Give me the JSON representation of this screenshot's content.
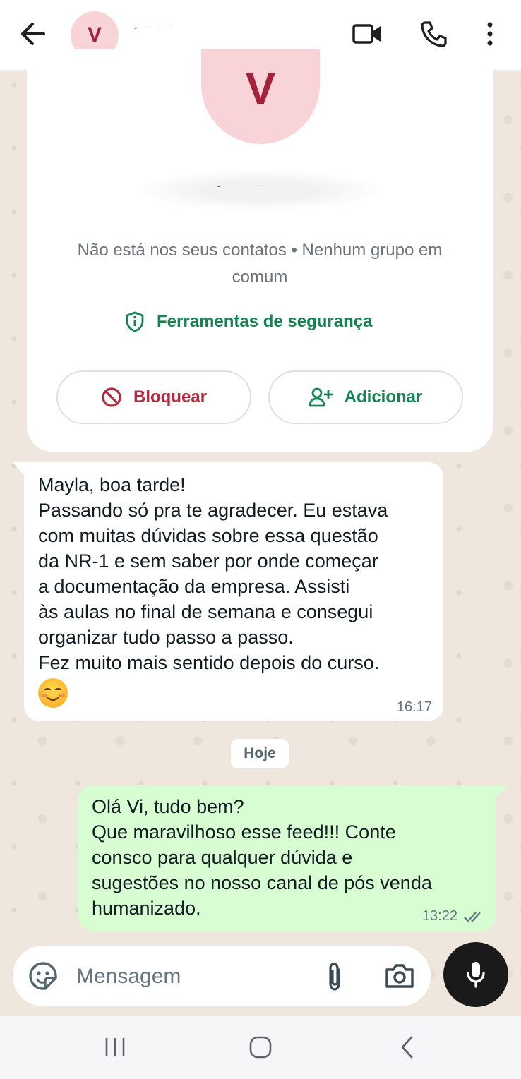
{
  "header": {
    "avatar_letter": "V",
    "contact_name": "˘ ˙ ˙ ˙"
  },
  "contact_card": {
    "avatar_letter": "V",
    "name_blurred": "˘ ˙ ˙",
    "info_text": "Não está nos seus contatos • Nenhum grupo em comum",
    "safety_tools_label": "Ferramentas de segurança",
    "block_label": "Bloquear",
    "add_label": "Adicionar"
  },
  "messages": [
    {
      "direction": "incoming",
      "text": "Mayla, boa tarde!\nPassando só pra te agradecer. Eu estava\ncom muitas dúvidas sobre essa questão\nda NR-1 e sem saber por onde começar\na documentação da empresa. Assisti\nàs aulas no final de semana e consegui\norganizar tudo passo a passo.\nFez muito mais sentido depois do curso.",
      "emoji": "smiling-face-icon",
      "time": "16:17"
    },
    {
      "direction": "outgoing",
      "text": "Olá Vi, tudo bem?\nQue maravilhoso esse feed!!! Conte\nconsco para qualquer dúvida e\nsugestões no nosso canal de pós venda\nhumanizado.",
      "time": "13:22",
      "status": "read"
    }
  ],
  "date_chip": "Hoje",
  "composer": {
    "placeholder": "Mensagem",
    "value": ""
  },
  "colors": {
    "accent_green": "#138452",
    "block_red": "#b5283e",
    "outgoing_bubble": "#d9fdd3",
    "avatar_bg": "#f8d4d9",
    "avatar_fg": "#a4223a"
  }
}
